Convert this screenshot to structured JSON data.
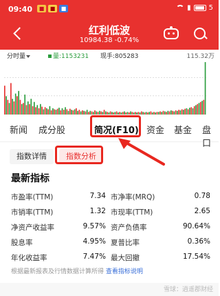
{
  "status_bar": {
    "time": "09:40",
    "app_icons": [
      "app-icon-1",
      "app-icon-2",
      "app-icon-3"
    ],
    "battery": "5"
  },
  "header": {
    "title": "红利低波",
    "subtitle": "10984.38  -0.74%"
  },
  "chart_info": {
    "period": "分时量",
    "volume": "量:1153231",
    "current": "现手:805283",
    "max": "115.32万"
  },
  "tabs": [
    "新闻",
    "成分股",
    "简况(F10)",
    "资金",
    "基金",
    "盘口"
  ],
  "active_tab": "简况(F10)",
  "subtabs": [
    "指数详情",
    "指数分析"
  ],
  "active_subtab": "指数分析",
  "section_title": "最新指标",
  "metrics": [
    {
      "label_left": "市盈率(TTM)",
      "value_left": "7.34",
      "label_right": "市净率(MRQ)",
      "value_right": "0.78"
    },
    {
      "label_left": "市销率(TTM)",
      "value_left": "1.32",
      "label_right": "市现率(TTM)",
      "value_right": "2.65"
    },
    {
      "label_left": "净资产收益率",
      "value_left": "9.57%",
      "label_right": "资产负债率",
      "value_right": "90.64%"
    },
    {
      "label_left": "股息率",
      "value_left": "4.95%",
      "label_right": "夏普比率",
      "value_right": "0.36%"
    },
    {
      "label_left": "年化收益率",
      "value_left": "7.47%",
      "label_right": "最大回撤",
      "value_right": "17.54%"
    }
  ],
  "footnote": {
    "text": "根据最新报表及行情数据计算所得",
    "link": "查看指标说明"
  },
  "watermark": "雪球：逍遥郡财经",
  "colors": {
    "brand_red": "#e8312f",
    "highlight_red": "#e8271f",
    "up_red": "#e8312f",
    "down_green": "#2a9c3c"
  },
  "chart_data": {
    "type": "bar",
    "bars": [
      {
        "v": 0.55,
        "c": "r"
      },
      {
        "v": 0.35,
        "c": "g"
      },
      {
        "v": 0.28,
        "c": "r"
      },
      {
        "v": 0.22,
        "c": "g"
      },
      {
        "v": 0.6,
        "c": "r"
      },
      {
        "v": 0.3,
        "c": "g"
      },
      {
        "v": 0.25,
        "c": "r"
      },
      {
        "v": 0.4,
        "c": "g"
      },
      {
        "v": 0.35,
        "c": "r"
      },
      {
        "v": 0.45,
        "c": "g"
      },
      {
        "v": 0.28,
        "c": "r"
      },
      {
        "v": 0.2,
        "c": "g"
      },
      {
        "v": 0.22,
        "c": "r"
      },
      {
        "v": 0.38,
        "c": "g"
      },
      {
        "v": 0.18,
        "c": "r"
      },
      {
        "v": 0.25,
        "c": "g"
      },
      {
        "v": 0.2,
        "c": "r"
      },
      {
        "v": 0.3,
        "c": "g"
      },
      {
        "v": 0.16,
        "c": "r"
      },
      {
        "v": 0.24,
        "c": "g"
      },
      {
        "v": 0.14,
        "c": "r"
      },
      {
        "v": 0.18,
        "c": "g"
      },
      {
        "v": 0.12,
        "c": "r"
      },
      {
        "v": 0.2,
        "c": "g"
      },
      {
        "v": 0.15,
        "c": "r"
      },
      {
        "v": 0.1,
        "c": "g"
      },
      {
        "v": 0.14,
        "c": "r"
      },
      {
        "v": 0.12,
        "c": "g"
      },
      {
        "v": 0.1,
        "c": "r"
      },
      {
        "v": 0.16,
        "c": "g"
      },
      {
        "v": 0.08,
        "c": "r"
      },
      {
        "v": 0.12,
        "c": "g"
      },
      {
        "v": 0.1,
        "c": "r"
      },
      {
        "v": 0.09,
        "c": "g"
      },
      {
        "v": 0.11,
        "c": "r"
      },
      {
        "v": 0.13,
        "c": "g"
      },
      {
        "v": 0.08,
        "c": "r"
      },
      {
        "v": 0.12,
        "c": "g"
      },
      {
        "v": 0.09,
        "c": "r"
      },
      {
        "v": 0.14,
        "c": "g"
      },
      {
        "v": 0.1,
        "c": "r"
      },
      {
        "v": 0.07,
        "c": "g"
      },
      {
        "v": 0.11,
        "c": "r"
      },
      {
        "v": 0.09,
        "c": "g"
      },
      {
        "v": 0.08,
        "c": "r"
      },
      {
        "v": 0.1,
        "c": "g"
      },
      {
        "v": 0.12,
        "c": "r"
      },
      {
        "v": 0.07,
        "c": "g"
      },
      {
        "v": 0.09,
        "c": "r"
      },
      {
        "v": 0.06,
        "c": "g"
      },
      {
        "v": 0.08,
        "c": "r"
      },
      {
        "v": 0.07,
        "c": "g"
      },
      {
        "v": 0.06,
        "c": "r"
      },
      {
        "v": 0.09,
        "c": "g"
      },
      {
        "v": 0.05,
        "c": "r"
      },
      {
        "v": 0.07,
        "c": "g"
      },
      {
        "v": 0.06,
        "c": "r"
      },
      {
        "v": 0.05,
        "c": "g"
      },
      {
        "v": 0.08,
        "c": "r"
      },
      {
        "v": 0.06,
        "c": "g"
      },
      {
        "v": 0.05,
        "c": "r"
      },
      {
        "v": 0.07,
        "c": "g"
      },
      {
        "v": 0.06,
        "c": "r"
      },
      {
        "v": 0.05,
        "c": "g"
      },
      {
        "v": 0.09,
        "c": "r"
      },
      {
        "v": 0.06,
        "c": "g"
      },
      {
        "v": 0.05,
        "c": "r"
      },
      {
        "v": 0.04,
        "c": "g"
      },
      {
        "v": 0.06,
        "c": "r"
      },
      {
        "v": 0.05,
        "c": "g"
      },
      {
        "v": 0.04,
        "c": "r"
      },
      {
        "v": 0.05,
        "c": "g"
      },
      {
        "v": 0.06,
        "c": "r"
      },
      {
        "v": 0.04,
        "c": "g"
      },
      {
        "v": 0.05,
        "c": "r"
      },
      {
        "v": 0.04,
        "c": "g"
      },
      {
        "v": 0.05,
        "c": "r"
      },
      {
        "v": 0.06,
        "c": "g"
      },
      {
        "v": 0.04,
        "c": "r"
      },
      {
        "v": 0.05,
        "c": "g"
      },
      {
        "v": 0.04,
        "c": "r"
      },
      {
        "v": 0.06,
        "c": "g"
      },
      {
        "v": 0.05,
        "c": "r"
      },
      {
        "v": 0.04,
        "c": "g"
      },
      {
        "v": 0.05,
        "c": "r"
      },
      {
        "v": 0.04,
        "c": "g"
      },
      {
        "v": 0.05,
        "c": "r"
      },
      {
        "v": 0.04,
        "c": "g"
      },
      {
        "v": 0.06,
        "c": "r"
      },
      {
        "v": 0.05,
        "c": "g"
      },
      {
        "v": 0.04,
        "c": "r"
      },
      {
        "v": 0.05,
        "c": "g"
      },
      {
        "v": 0.04,
        "c": "r"
      },
      {
        "v": 0.05,
        "c": "g"
      },
      {
        "v": 0.06,
        "c": "r"
      },
      {
        "v": 0.04,
        "c": "g"
      },
      {
        "v": 0.05,
        "c": "r"
      },
      {
        "v": 0.04,
        "c": "g"
      },
      {
        "v": 0.05,
        "c": "r"
      },
      {
        "v": 0.05,
        "c": "g"
      },
      {
        "v": 0.06,
        "c": "r"
      },
      {
        "v": 0.05,
        "c": "g"
      },
      {
        "v": 0.07,
        "c": "r"
      },
      {
        "v": 0.06,
        "c": "g"
      },
      {
        "v": 0.05,
        "c": "r"
      },
      {
        "v": 0.07,
        "c": "g"
      },
      {
        "v": 0.06,
        "c": "r"
      },
      {
        "v": 0.08,
        "c": "g"
      },
      {
        "v": 0.07,
        "c": "r"
      },
      {
        "v": 0.06,
        "c": "g"
      },
      {
        "v": 0.08,
        "c": "r"
      },
      {
        "v": 0.07,
        "c": "g"
      },
      {
        "v": 0.09,
        "c": "r"
      },
      {
        "v": 0.08,
        "c": "g"
      },
      {
        "v": 0.1,
        "c": "r"
      },
      {
        "v": 0.09,
        "c": "g"
      },
      {
        "v": 0.11,
        "c": "r"
      },
      {
        "v": 0.12,
        "c": "g"
      },
      {
        "v": 0.1,
        "c": "r"
      },
      {
        "v": 0.13,
        "c": "g"
      },
      {
        "v": 0.14,
        "c": "r"
      },
      {
        "v": 0.12,
        "c": "g"
      },
      {
        "v": 0.16,
        "c": "r"
      },
      {
        "v": 0.18,
        "c": "g"
      },
      {
        "v": 0.2,
        "c": "r"
      },
      {
        "v": 0.22,
        "c": "g"
      },
      {
        "v": 0.24,
        "c": "r"
      },
      {
        "v": 0.26,
        "c": "g"
      },
      {
        "v": 0.28,
        "c": "r"
      },
      {
        "v": 1.0,
        "c": "g"
      }
    ]
  }
}
